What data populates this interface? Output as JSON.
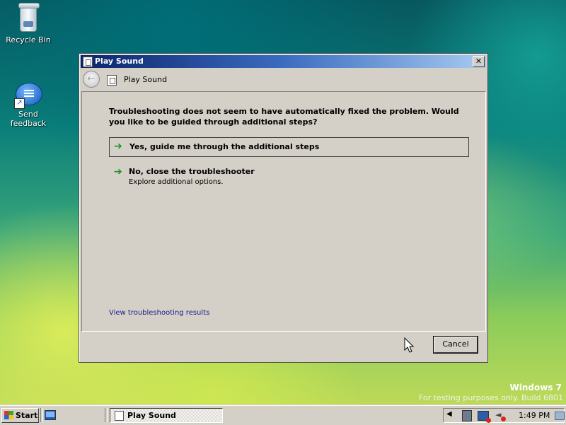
{
  "desktop": {
    "icons": [
      {
        "label": "Recycle Bin",
        "icon": "recycle-bin-icon"
      },
      {
        "label": "Send feedback",
        "icon": "feedback-bubble-icon"
      }
    ],
    "watermark": {
      "line1": "Windows  7",
      "line2": "For testing purposes only. Build 6801"
    }
  },
  "dialog": {
    "title": "Play Sound",
    "close_symbol": "✕",
    "nav": {
      "back_symbol": "←",
      "title": "Play Sound"
    },
    "prompt": "Troubleshooting does not seem to have automatically fixed the problem.  Would you like to be guided through additional steps?",
    "options": [
      {
        "label": "Yes, guide me through the additional steps",
        "description": ""
      },
      {
        "label": "No, close the troubleshooter",
        "description": "Explore additional options."
      }
    ],
    "arrow_symbol": "➔",
    "results_link": "View troubleshooting results",
    "cancel_label": "Cancel"
  },
  "taskbar": {
    "start_label": "Start",
    "task_button": "Play Sound",
    "tray_caret": "◀",
    "clock": "1:49 PM"
  },
  "colors": {
    "title_bar_start": "#0a246a",
    "title_bar_end": "#a6caf0",
    "dialog_face": "#d4d0c8",
    "link": "#1b1b8c",
    "option_arrow": "#1c8f1c"
  }
}
